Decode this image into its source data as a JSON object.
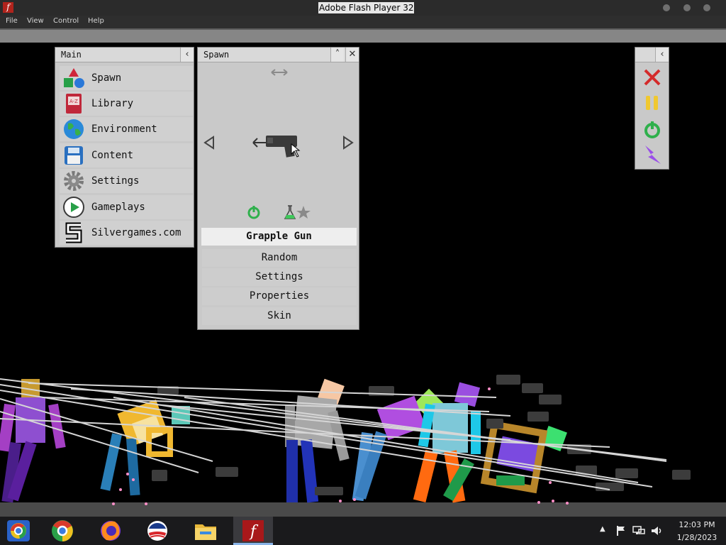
{
  "window": {
    "title": "Adobe Flash Player 32",
    "app_icon": "f"
  },
  "menubar": {
    "items": [
      "File",
      "View",
      "Control",
      "Help"
    ]
  },
  "main_panel": {
    "title": "Main",
    "items": [
      {
        "label": "Spawn",
        "icon": "shapes-icon"
      },
      {
        "label": "Library",
        "icon": "book-icon"
      },
      {
        "label": "Environment",
        "icon": "globe-icon"
      },
      {
        "label": "Content",
        "icon": "floppy-disk-icon"
      },
      {
        "label": "Settings",
        "icon": "gear-icon"
      },
      {
        "label": "Gameplays",
        "icon": "play-icon"
      },
      {
        "label": "Silvergames.com",
        "icon": "silvergames-logo-icon"
      }
    ]
  },
  "spawn_panel": {
    "title": "Spawn",
    "selected_item": "Grapple Gun",
    "buttons": [
      "Random",
      "Settings",
      "Properties",
      "Skin"
    ]
  },
  "tool_panel": {
    "buttons": [
      "delete-icon",
      "pause-icon",
      "power-icon",
      "lightning-icon"
    ]
  },
  "taskbar": {
    "apps": [
      "chrome-legacy-icon",
      "chrome-icon",
      "firefox-icon",
      "obama-logo-icon",
      "file-explorer-icon",
      "flash-player-icon"
    ],
    "time": "12:03 PM",
    "date": "1/28/2023"
  }
}
